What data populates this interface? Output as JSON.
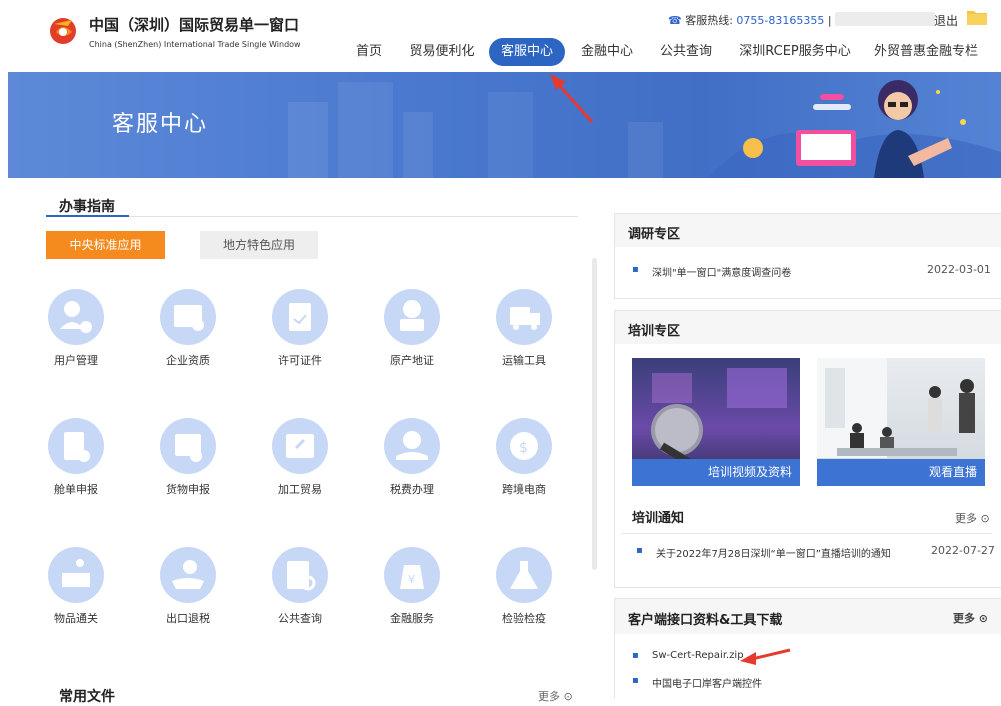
{
  "header": {
    "brand_cn": "中国（深圳）国际贸易单一窗口",
    "brand_en": "China (ShenZhen) International Trade Single Window",
    "hotline_label": "客服热线:",
    "hotline_number": "0755-83165355",
    "logout": "退出",
    "nav": [
      "首页",
      "贸易便利化",
      "客服中心",
      "金融中心",
      "公共查询",
      "深圳RCEP服务中心",
      "外贸普惠金融专栏"
    ],
    "active_nav": "客服中心"
  },
  "banner": {
    "title": "客服中心"
  },
  "guide": {
    "title": "办事指南",
    "tabs": [
      "中央标准应用",
      "地方特色应用"
    ],
    "services": [
      {
        "label": "用户管理",
        "icon": "user-settings-icon"
      },
      {
        "label": "企业资质",
        "icon": "certificate-icon"
      },
      {
        "label": "许可证件",
        "icon": "clipboard-check-icon"
      },
      {
        "label": "原产地证",
        "icon": "globe-basket-icon"
      },
      {
        "label": "运输工具",
        "icon": "truck-icon"
      },
      {
        "label": "舱单申报",
        "icon": "manifest-upload-icon"
      },
      {
        "label": "货物申报",
        "icon": "cargo-upload-icon"
      },
      {
        "label": "加工贸易",
        "icon": "tools-box-icon"
      },
      {
        "label": "税费办理",
        "icon": "yuan-hand-icon"
      },
      {
        "label": "跨境电商",
        "icon": "globe-dollar-icon"
      },
      {
        "label": "物品通关",
        "icon": "person-box-icon"
      },
      {
        "label": "出口退税",
        "icon": "hand-refund-icon"
      },
      {
        "label": "公共查询",
        "icon": "document-search-icon"
      },
      {
        "label": "金融服务",
        "icon": "money-bag-icon"
      },
      {
        "label": "检验检疫",
        "icon": "flask-icon"
      }
    ],
    "common_files": "常用文件",
    "more": "更多"
  },
  "survey": {
    "title": "调研专区",
    "items": [
      {
        "text": "深圳\"单一窗口\"满意度调查问卷",
        "date": "2022-03-01"
      }
    ]
  },
  "training": {
    "title": "培训专区",
    "images": [
      "培训视频及资料",
      "观看直播"
    ],
    "notice_title": "培训通知",
    "more": "更多",
    "items": [
      {
        "text": "关于2022年7月28日深圳“单一窗口”直播培训的通知",
        "date": "2022-07-27"
      }
    ]
  },
  "downloads": {
    "title": "客户端接口资料&工具下载",
    "more": "更多",
    "items": [
      "Sw-Cert-Repair.zip",
      "中国电子口岸客户端控件"
    ]
  },
  "colors": {
    "brand_blue": "#2d66c2",
    "orange": "#f58b1f",
    "annotation_red": "#e63a2e"
  }
}
